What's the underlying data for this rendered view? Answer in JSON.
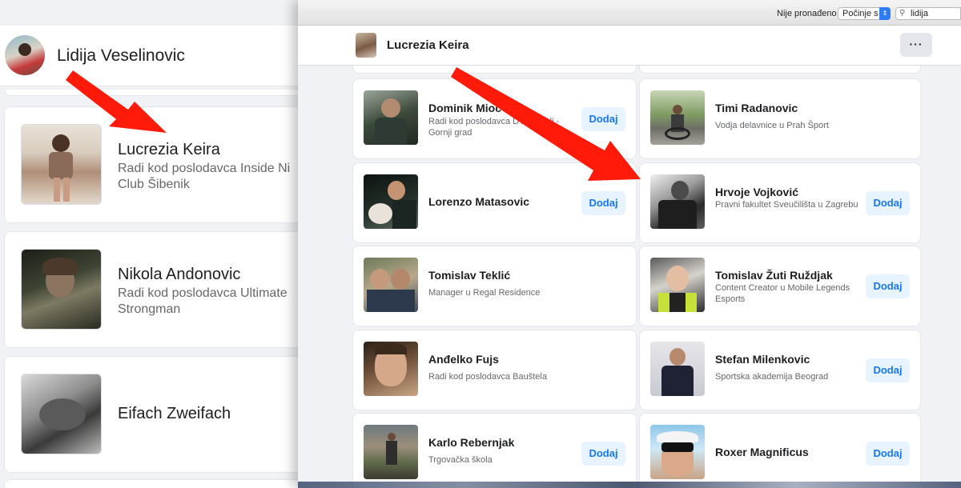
{
  "background_window": {
    "title": "Lidija Veselinovic",
    "cards": [
      {
        "name": "Lucrezia Keira",
        "line1": "Radi kod poslodavca Inside Ni",
        "line2": "Club Šibenik"
      },
      {
        "name": "Nikola Andonovic",
        "line1": "Radi kod poslodavca Ultimate",
        "line2": "Strongman"
      },
      {
        "name": "Eifach Zweifach",
        "line1": "",
        "line2": ""
      }
    ]
  },
  "find_bar": {
    "status_text": "Nije pronađeno",
    "match_mode": "Počinje s",
    "search_value": "lidija"
  },
  "profile_header": {
    "name": "Lucrezia Keira",
    "more_label": "···"
  },
  "friend_cards": [
    {
      "name": "Dominik Mioč",
      "desc": "Radi kod poslodavca DVD Ozalj - Gornji grad",
      "button": "Dodaj"
    },
    {
      "name": "Timi Radanovic",
      "desc": "Vodja delavnice u Prah Šport",
      "button": ""
    },
    {
      "name": "Lorenzo Matasovic",
      "desc": "",
      "button": "Dodaj"
    },
    {
      "name": "Hrvoje Vojković",
      "desc": "Pravni fakultet Sveučilišta u Zagrebu",
      "button": "Dodaj"
    },
    {
      "name": "Tomislav Teklić",
      "desc": "Manager u Regal Residence",
      "button": ""
    },
    {
      "name": "Tomislav Žuti Ruždjak",
      "desc": "Content Creator u Mobile Legends Esports",
      "button": "Dodaj"
    },
    {
      "name": "Anđelko Fujs",
      "desc": "Radi kod poslodavca Bauštela",
      "button": ""
    },
    {
      "name": "Stefan Milenkovic",
      "desc": "Sportska akademija Beograd",
      "button": "Dodaj"
    },
    {
      "name": "Karlo Rebernjak",
      "desc": "Trgovačka škola",
      "button": "Dodaj"
    },
    {
      "name": "Roxer Magnificus",
      "desc": "",
      "button": "Dodaj"
    }
  ],
  "colors": {
    "accent": "#1877f2",
    "add_button_bg": "#e7f3ff",
    "annotation_arrow": "#ff1a0a"
  }
}
